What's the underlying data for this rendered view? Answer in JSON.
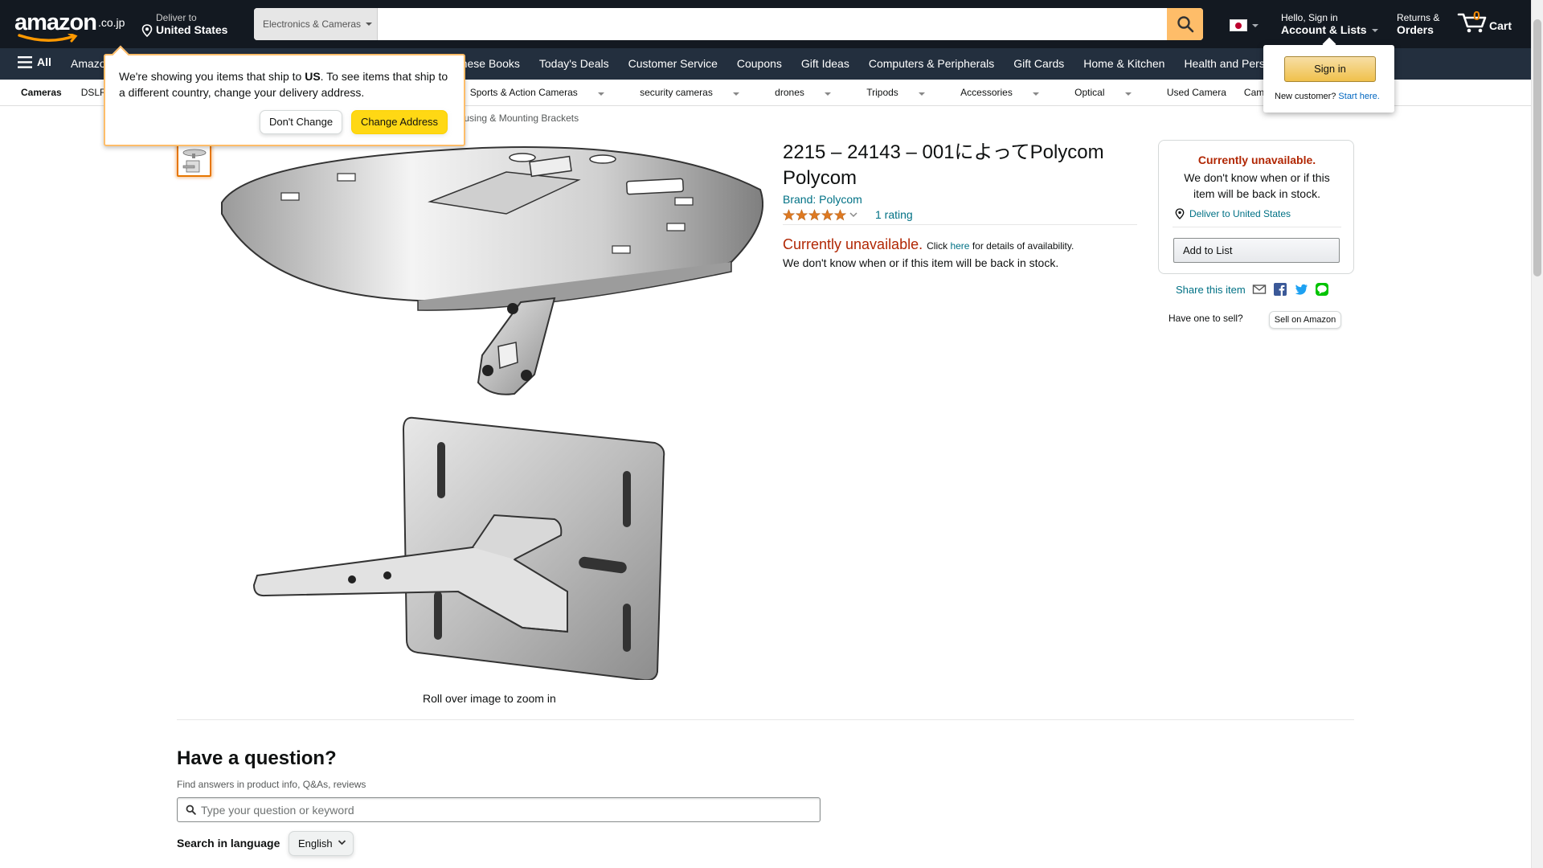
{
  "header": {
    "logo_word": "amazon",
    "logo_tld": ".co.jp",
    "deliver_line1": "Deliver to",
    "deliver_line2": "United States",
    "search_category": "Electronics & Cameras",
    "search_value": "",
    "account_line1": "Hello, Sign in",
    "account_line2": "Account & Lists",
    "returns_line1": "Returns &",
    "returns_line2": "Orders",
    "cart_count": "0",
    "cart_label": "Cart"
  },
  "mainnav": {
    "all_label": "All",
    "links": [
      "Amazon",
      "",
      "",
      "",
      "",
      "Japanese Books",
      "Today's Deals",
      "Customer Service",
      "Coupons",
      "Gift Ideas",
      "Computers & Peripherals",
      "Gift Cards",
      "Home & Kitchen",
      "Health and Personal Care"
    ]
  },
  "subnav": {
    "items": [
      "Cameras",
      "DSLR",
      "Sports & Action Cameras",
      "security cameras",
      "drones",
      "Tripods",
      "Accessories",
      "Optical",
      "Used Camera",
      "Camera Bargain"
    ]
  },
  "breadcrumb": "ce Housing & Mounting Brackets",
  "product": {
    "title": "2215 – 24143 – 001によってPolycom Polycom",
    "brand": "Brand: Polycom",
    "rating_count": "1 rating",
    "stars": 5,
    "unavailable_big": "Currently unavailable.",
    "unavailable_click": "Click",
    "unavailable_here": "here",
    "unavailable_rest": "for details of availability.",
    "back_in_stock": "We don't know when or if this item will be back in stock.",
    "zoom_caption": "Roll over image to zoom in"
  },
  "buybox": {
    "title": "Currently unavailable.",
    "text": "We don't know when or if this item will be back in stock.",
    "deliver": "Deliver to United States",
    "add_to_list": "Add to List"
  },
  "share": {
    "label": "Share this item"
  },
  "sell": {
    "label": "Have one to sell?",
    "button": "Sell on Amazon"
  },
  "question": {
    "title": "Have a question?",
    "subtitle": "Find answers in product info, Q&As, reviews",
    "placeholder": "Type your question or keyword",
    "language_label": "Search in language",
    "language_value": "English"
  },
  "ship_popover": {
    "text_before": "We're showing you items that ship to ",
    "country": "US",
    "text_after": ". To see items that ship to a different country, change your delivery address.",
    "dont_change": "Don't Change",
    "change_address": "Change Address"
  },
  "signin_flyout": {
    "button": "Sign in",
    "new_customer": "New customer?",
    "start_here": "Start here."
  },
  "colors": {
    "nav_dark": "#131921",
    "nav_mid": "#232f3e",
    "accent": "#febd69",
    "link": "#007185",
    "price_red": "#b12704"
  }
}
